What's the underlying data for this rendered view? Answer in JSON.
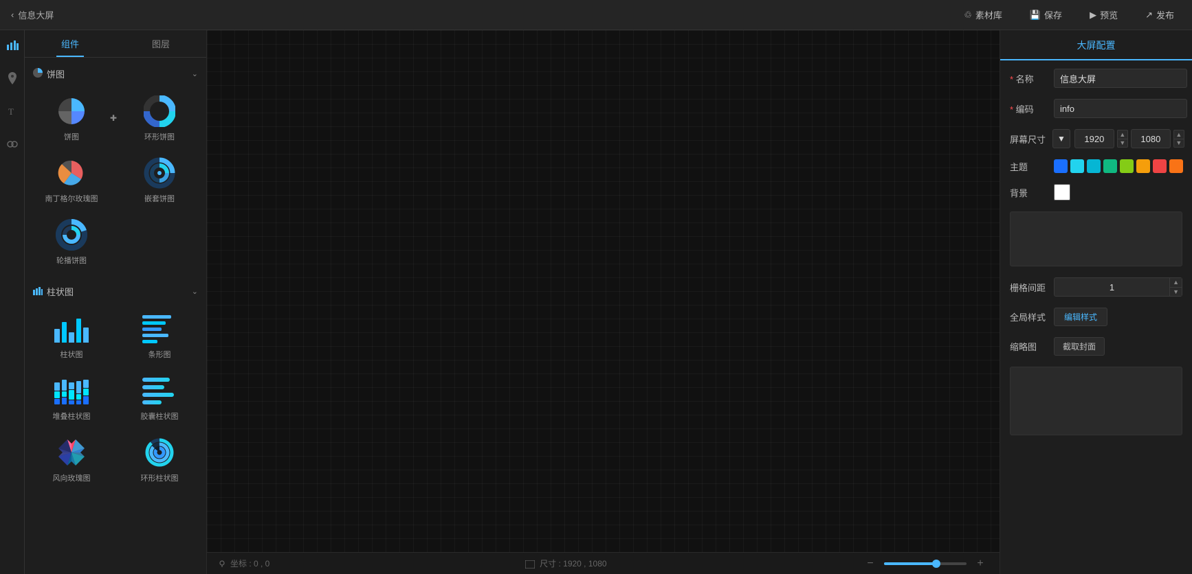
{
  "topbar": {
    "back_label": "信息大屏",
    "assets_label": "素材库",
    "save_label": "保存",
    "preview_label": "预览",
    "publish_label": "发布"
  },
  "left_panel": {
    "tab_components": "组件",
    "tab_layers": "图层",
    "categories": [
      {
        "id": "pie",
        "icon": "●",
        "label": "饼图",
        "collapsed": false,
        "widgets": [
          {
            "label": "饼图",
            "type": "pie"
          },
          {
            "label": "环形饼图",
            "type": "donut"
          },
          {
            "label": "南丁格尔玫瑰图",
            "type": "rose"
          },
          {
            "label": "嵌套饼图",
            "type": "nested"
          },
          {
            "label": "轮播饼图",
            "type": "carousel-pie"
          }
        ]
      },
      {
        "id": "bar",
        "icon": "▐",
        "label": "柱状图",
        "collapsed": false,
        "widgets": [
          {
            "label": "柱状图",
            "type": "bar"
          },
          {
            "label": "条形图",
            "type": "hbar"
          },
          {
            "label": "堆叠柱状图",
            "type": "stacked-bar"
          },
          {
            "label": "胶囊柱状图",
            "type": "capsule-bar"
          },
          {
            "label": "风向玫瑰图",
            "type": "wind-rose"
          },
          {
            "label": "环形柱状图",
            "type": "torus-bar"
          }
        ]
      }
    ]
  },
  "canvas": {
    "coordinate": "坐标 : 0 , 0",
    "size_label": "尺寸 : 1920 , 1080",
    "zoom_percent": 65
  },
  "right_panel": {
    "title": "大屏配置",
    "name_label": "名称",
    "name_value": "信息大屏",
    "code_label": "编码",
    "code_value": "info",
    "screen_size_label": "屏幕尺寸",
    "width_value": "1920",
    "height_value": "1080",
    "theme_label": "主题",
    "background_label": "背景",
    "grid_label": "栅格间距",
    "grid_value": "1",
    "global_style_label": "全局样式",
    "global_style_btn": "编辑样式",
    "thumbnail_label": "缩略图",
    "thumbnail_btn": "截取封面",
    "theme_colors": [
      "#1a6fff",
      "#22d3ee",
      "#06b6d4",
      "#10b981",
      "#84cc16",
      "#f59e0b",
      "#ef4444",
      "#f97316"
    ]
  }
}
